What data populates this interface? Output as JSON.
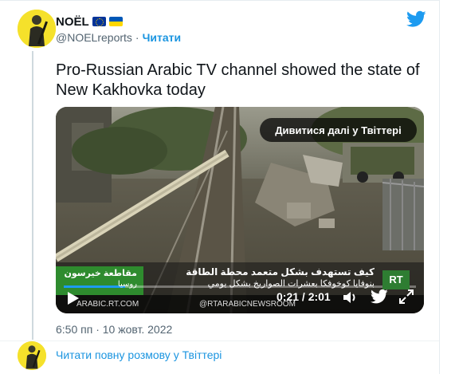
{
  "author": {
    "name": "NOËL",
    "handle": "@NOELreports",
    "separator": "·",
    "follow_label": "Читати"
  },
  "tweet": {
    "text": "Pro-Russian Arabic TV channel showed the state of New Kakhovka today",
    "timestamp": "6:50 пп · 10 жовт. 2022"
  },
  "media": {
    "watch_more_label": "Дивитися далі у Твіттері",
    "time": "0:21 / 2:01",
    "overlay_text_1": "كيف تستهدف بشكل متعمد محطة الطاقة",
    "overlay_text_2": "بنوفايا كوخوفكا بعشرات الصواريخ بشكل يومي",
    "overlay_location_1": "مقاطعة خيرسون",
    "overlay_location_2": "روسيا",
    "watermark_left": "ARABIC.RT.COM",
    "watermark_right": "@RTARABICNEWSROOM",
    "channel_logo": "RT"
  },
  "footer": {
    "read_more_label": "Читати повну розмову у Твіттері"
  },
  "colors": {
    "link": "#1b95e0",
    "text": "#0f1419",
    "muted": "#536471"
  }
}
